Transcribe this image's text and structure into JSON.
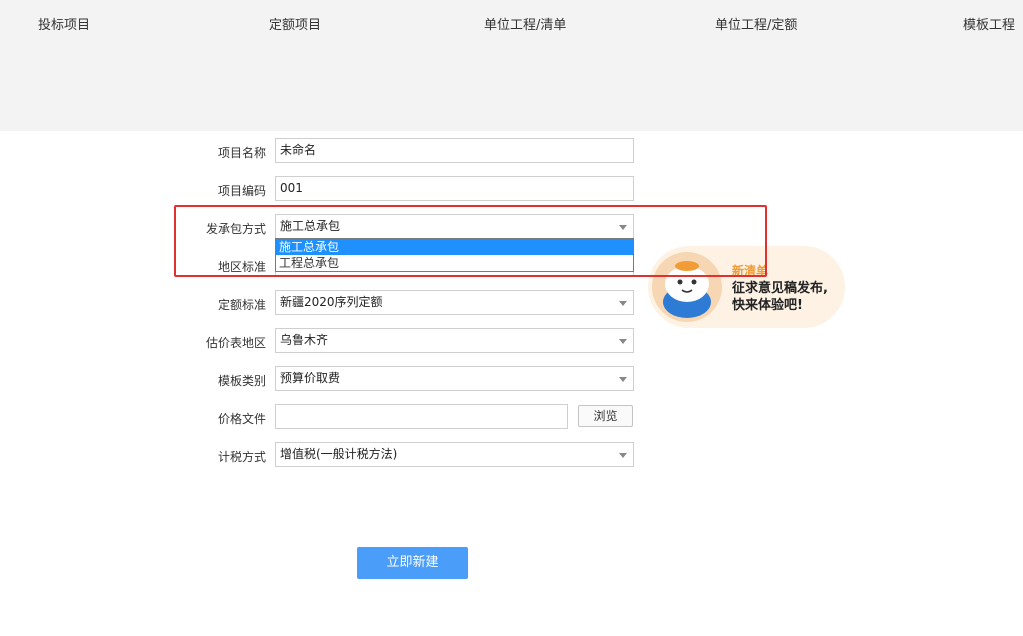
{
  "tabs": [
    "投标项目",
    "定额项目",
    "单位工程/清单",
    "单位工程/定额",
    "模板工程"
  ],
  "form": {
    "project_name": {
      "label": "项目名称",
      "value": "未命名"
    },
    "project_code": {
      "label": "项目编码",
      "value": "001"
    },
    "contract_mode": {
      "label": "发承包方式",
      "value": "施工总承包",
      "options": [
        "施工总承包",
        "工程总承包"
      ]
    },
    "region_standard": {
      "label": "地区标准"
    },
    "quota_standard": {
      "label": "定额标准",
      "value": "新疆2020序列定额"
    },
    "price_region": {
      "label": "估价表地区",
      "value": "乌鲁木齐"
    },
    "template_type": {
      "label": "模板类别",
      "value": "预算价取费"
    },
    "price_file": {
      "label": "价格文件",
      "value": "",
      "browse": "浏览"
    },
    "tax_method": {
      "label": "计税方式",
      "value": "增值税(一般计税方法)"
    }
  },
  "submit_label": "立即新建",
  "promo": {
    "title": "新清单",
    "line1": "征求意见稿发布,",
    "line2": "快来体验吧!"
  },
  "colors": {
    "accent": "#4a9df8",
    "highlight": "#e03030",
    "dropdown_selected": "#1e90ff"
  }
}
